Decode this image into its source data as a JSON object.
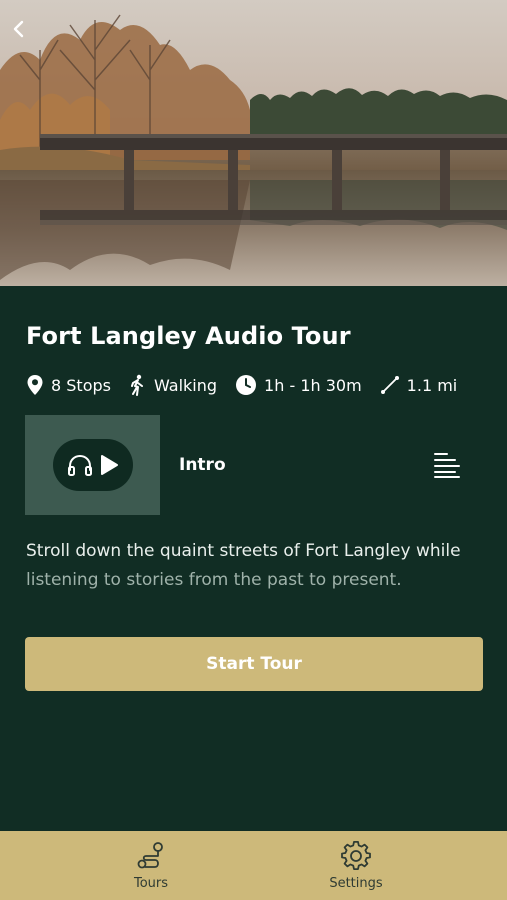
{
  "tour": {
    "title": "Fort Langley Audio Tour",
    "stops": "8 Stops",
    "mode": "Walking",
    "duration": "1h - 1h 30m",
    "distance": "1.1 mi",
    "description_lead": "Stroll down the quaint streets of Fort Langley while",
    "description_tail": "listening to stories from the past to present."
  },
  "player": {
    "track_title": "Intro"
  },
  "actions": {
    "start_label": "Start Tour"
  },
  "tabs": [
    {
      "label": "Tours",
      "icon": "route-icon"
    },
    {
      "label": "Settings",
      "icon": "gear-icon"
    }
  ],
  "colors": {
    "background": "#112d24",
    "accent": "#cdb97a",
    "thumb": "#3d5a50"
  }
}
